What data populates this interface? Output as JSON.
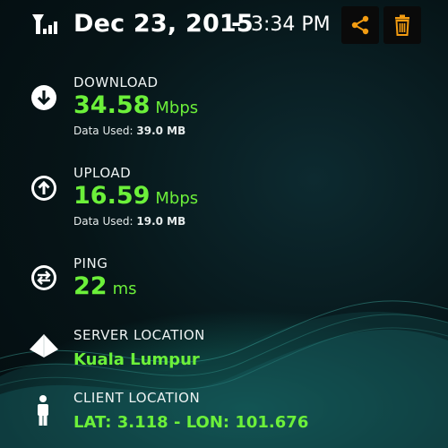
{
  "header": {
    "date": "Dec 23, 2015",
    "separator": "-",
    "time": "3:34 PM",
    "share_icon": "share-icon",
    "delete_icon": "trash-icon",
    "accent_color": "#f39c12"
  },
  "download": {
    "label": "DOWNLOAD",
    "value": "34.58",
    "unit": "Mbps",
    "data_used_label": "Data Used:",
    "data_used_value": "39.0 MB"
  },
  "upload": {
    "label": "UPLOAD",
    "value": "16.59",
    "unit": "Mbps",
    "data_used_label": "Data Used:",
    "data_used_value": "19.0 MB"
  },
  "ping": {
    "label": "PING",
    "value": "22",
    "unit": "ms"
  },
  "server": {
    "label": "SERVER LOCATION",
    "value": "Kuala Lumpur"
  },
  "client": {
    "label": "CLIENT LOCATION",
    "value": "LAT: 3.118 - LON: 101.676"
  },
  "colors": {
    "value_green": "#6cf03a",
    "background": "#061417"
  }
}
